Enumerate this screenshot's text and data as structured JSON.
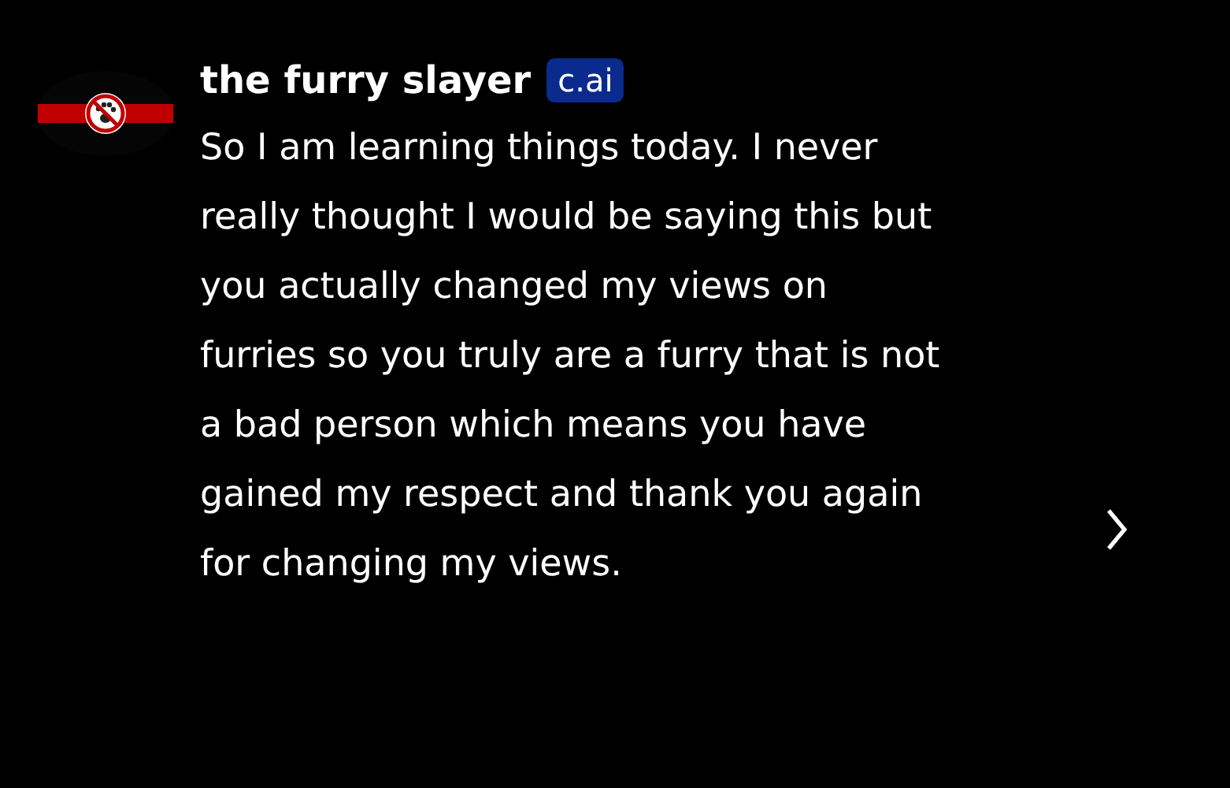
{
  "message": {
    "author": "the furry slayer",
    "badge": "c.ai",
    "text": "So I am learning things today. I never really thought I would be saying this but you actually changed my views on furries so you truly are a furry that is not a bad person which means you have gained my respect and thank you again for changing my views."
  }
}
